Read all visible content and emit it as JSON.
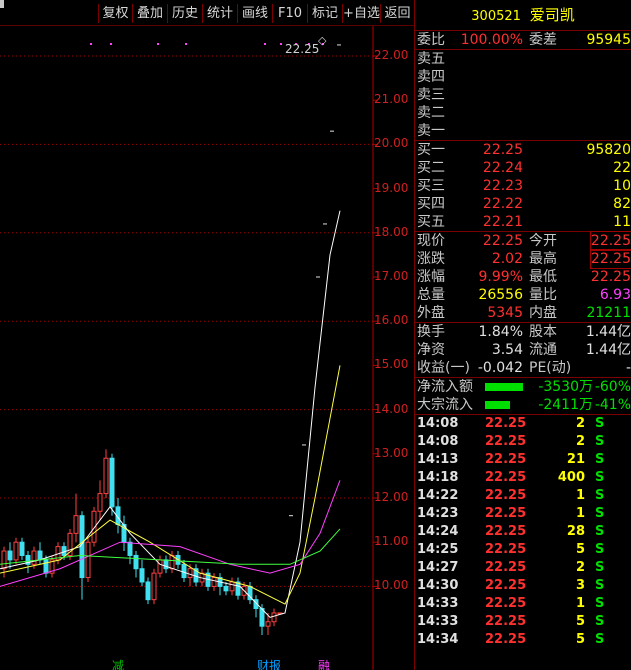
{
  "toolbar": {
    "buttons": [
      "复权",
      "叠加",
      "历史",
      "统计",
      "画线",
      "F10",
      "标记",
      "+自选",
      "返回"
    ]
  },
  "chart": {
    "price_labels": [
      "22.00",
      "21.00",
      "20.00",
      "19.00",
      "18.00",
      "17.00",
      "16.00",
      "15.00",
      "14.00",
      "13.00",
      "12.00",
      "11.00",
      "10.00"
    ],
    "high_label": "22.25",
    "bottom_tags": [
      {
        "text": "减",
        "color": "#00c000"
      },
      {
        "text": "财报",
        "color": "#00a0ff"
      },
      {
        "text": "融",
        "color": "#ff40ff"
      }
    ]
  },
  "quote": {
    "code": "300521",
    "name": "爱司凯",
    "wei_bi_label": "委比",
    "wei_bi": "100.00%",
    "wei_cha_label": "委差",
    "wei_cha": "95945",
    "sell": [
      {
        "label": "卖五",
        "price": "",
        "vol": ""
      },
      {
        "label": "卖四",
        "price": "",
        "vol": ""
      },
      {
        "label": "卖三",
        "price": "",
        "vol": ""
      },
      {
        "label": "卖二",
        "price": "",
        "vol": ""
      },
      {
        "label": "卖一",
        "price": "",
        "vol": ""
      }
    ],
    "buy": [
      {
        "label": "买一",
        "price": "22.25",
        "vol": "95820"
      },
      {
        "label": "买二",
        "price": "22.24",
        "vol": "22"
      },
      {
        "label": "买三",
        "price": "22.23",
        "vol": "10"
      },
      {
        "label": "买四",
        "price": "22.22",
        "vol": "82"
      },
      {
        "label": "买五",
        "price": "22.21",
        "vol": "11"
      }
    ],
    "stats": [
      {
        "l1": "现价",
        "v1": "22.25",
        "c1": "red",
        "l2": "今开",
        "v2": "22.25",
        "c2": "red",
        "box2": true
      },
      {
        "l1": "涨跌",
        "v1": "2.02",
        "c1": "red",
        "l2": "最高",
        "v2": "22.25",
        "c2": "red",
        "box2": true
      },
      {
        "l1": "涨幅",
        "v1": "9.99%",
        "c1": "red",
        "l2": "最低",
        "v2": "22.25",
        "c2": "red",
        "box2": false
      },
      {
        "l1": "总量",
        "v1": "26556",
        "c1": "yellow",
        "l2": "量比",
        "v2": "6.93",
        "c2": "magenta",
        "box2": false
      },
      {
        "l1": "外盘",
        "v1": "5345",
        "c1": "red",
        "l2": "内盘",
        "v2": "21211",
        "c2": "green",
        "box2": false
      }
    ],
    "stats2": [
      {
        "l1": "换手",
        "v1": "1.84%",
        "c1": "white",
        "l2": "股本",
        "v2": "1.44亿",
        "c2": "white"
      },
      {
        "l1": "净资",
        "v1": "3.54",
        "c1": "white",
        "l2": "流通",
        "v2": "1.44亿",
        "c2": "white"
      },
      {
        "l1": "收益(一)",
        "v1": "-0.042",
        "c1": "white",
        "l2": "PE(动)",
        "v2": "-",
        "c2": "white"
      }
    ],
    "flows": [
      {
        "label": "净流入额",
        "bar": 0.85,
        "value": "-3530万",
        "pct": "-60%"
      },
      {
        "label": "大宗流入",
        "bar": 0.55,
        "value": "-2411万",
        "pct": "-41%"
      }
    ],
    "trades": [
      {
        "time": "14:08",
        "price": "22.25",
        "vol": "2",
        "side": "S"
      },
      {
        "time": "14:08",
        "price": "22.25",
        "vol": "2",
        "side": "S"
      },
      {
        "time": "14:13",
        "price": "22.25",
        "vol": "21",
        "side": "S"
      },
      {
        "time": "14:18",
        "price": "22.25",
        "vol": "400",
        "side": "S"
      },
      {
        "time": "14:22",
        "price": "22.25",
        "vol": "1",
        "side": "S"
      },
      {
        "time": "14:23",
        "price": "22.25",
        "vol": "1",
        "side": "S"
      },
      {
        "time": "14:24",
        "price": "22.25",
        "vol": "28",
        "side": "S"
      },
      {
        "time": "14:25",
        "price": "22.25",
        "vol": "5",
        "side": "S"
      },
      {
        "time": "14:27",
        "price": "22.25",
        "vol": "2",
        "side": "S"
      },
      {
        "time": "14:30",
        "price": "22.25",
        "vol": "3",
        "side": "S"
      },
      {
        "time": "14:33",
        "price": "22.25",
        "vol": "1",
        "side": "S"
      },
      {
        "time": "14:33",
        "price": "22.25",
        "vol": "5",
        "side": "S"
      },
      {
        "time": "14:34",
        "price": "22.25",
        "vol": "5",
        "side": "S"
      }
    ]
  }
}
